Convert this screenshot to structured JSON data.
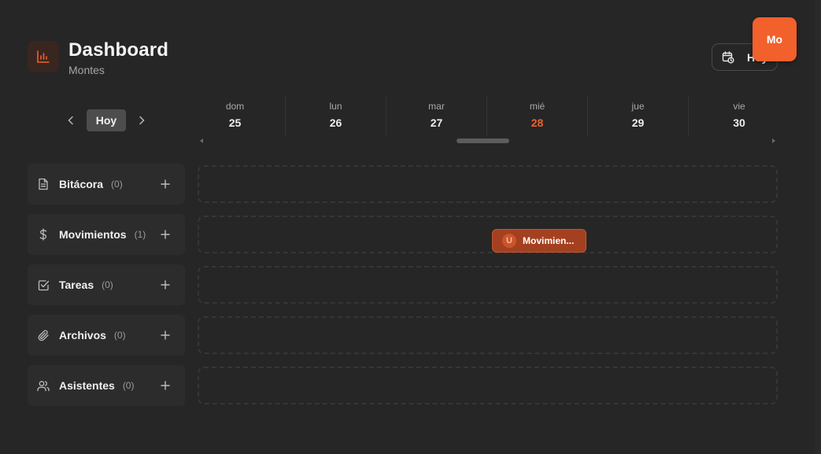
{
  "header": {
    "title": "Dashboard",
    "subtitle": "Montes",
    "today_button_label": "Hoy",
    "avatar_initials": "Mo"
  },
  "nav": {
    "today_label": "Hoy"
  },
  "days": [
    {
      "name": "dom",
      "num": "25",
      "is_today": false
    },
    {
      "name": "lun",
      "num": "26",
      "is_today": false
    },
    {
      "name": "mar",
      "num": "27",
      "is_today": false
    },
    {
      "name": "mié",
      "num": "28",
      "is_today": true
    },
    {
      "name": "jue",
      "num": "29",
      "is_today": false
    },
    {
      "name": "vie",
      "num": "30",
      "is_today": false
    }
  ],
  "rows": [
    {
      "label": "Bitácora",
      "count": "(0)",
      "icon": "document-icon"
    },
    {
      "label": "Movimientos",
      "count": "(1)",
      "icon": "dollar-icon"
    },
    {
      "label": "Tareas",
      "count": "(0)",
      "icon": "checkbox-icon"
    },
    {
      "label": "Archivos",
      "count": "(0)",
      "icon": "paperclip-icon"
    },
    {
      "label": "Asistentes",
      "count": "(0)",
      "icon": "users-icon"
    }
  ],
  "event": {
    "badge": "U",
    "label": "Movimien..."
  },
  "colors": {
    "accent": "#f2602c",
    "background": "#262626",
    "panel": "#2c2c2c"
  }
}
